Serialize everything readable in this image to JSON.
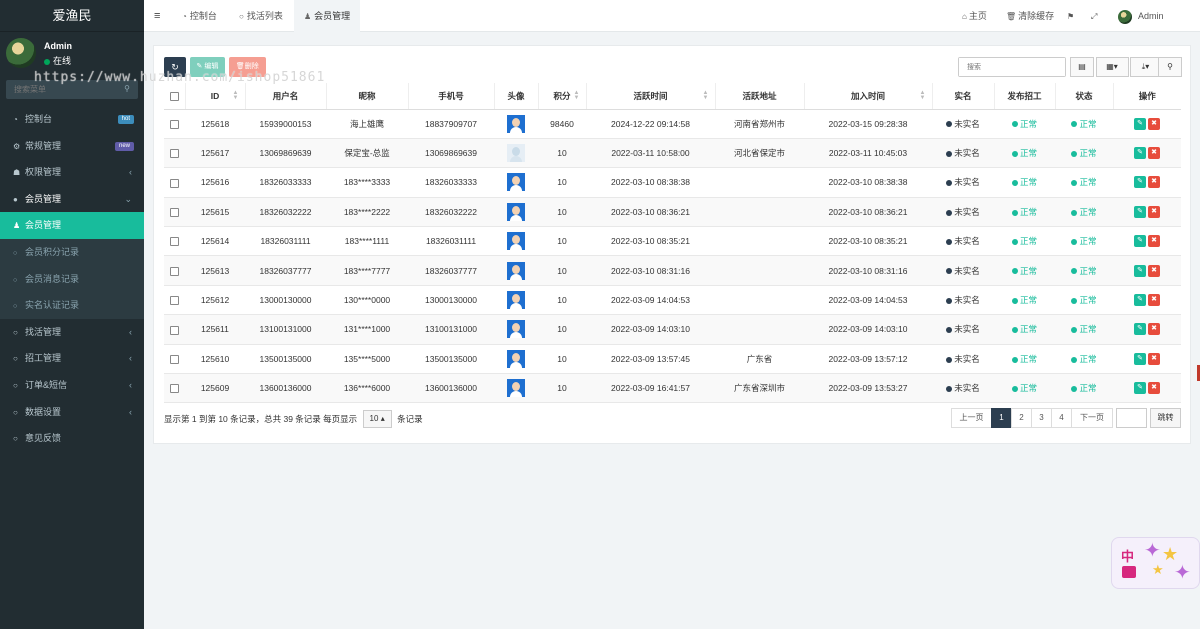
{
  "sidebar": {
    "brand": "爱渔民",
    "user": {
      "name": "Admin",
      "status": "在线"
    },
    "search_placeholder": "搜索菜单",
    "items": [
      {
        "name": "dashboard",
        "icon": "dashboard-icon",
        "glyph": "◔",
        "label": "控制台",
        "badge": "hot",
        "type": "top"
      },
      {
        "name": "general",
        "icon": "cogs-icon",
        "glyph": "⚙",
        "label": "常规管理",
        "badge": "new",
        "type": "top"
      },
      {
        "name": "permission",
        "icon": "group-icon",
        "glyph": "☗",
        "label": "权限管理",
        "arrow": "‹",
        "type": "top"
      },
      {
        "name": "members",
        "icon": "user-circle-icon",
        "glyph": "●",
        "label": "会员管理",
        "arrow": "⌄",
        "type": "open"
      },
      {
        "name": "member-manage",
        "icon": "user-icon",
        "glyph": "♟",
        "label": "会员管理",
        "type": "active"
      },
      {
        "name": "member-points",
        "icon": "circle-icon",
        "glyph": "○",
        "label": "会员积分记录",
        "type": "sub"
      },
      {
        "name": "member-messages",
        "icon": "circle-icon",
        "glyph": "○",
        "label": "会员消息记录",
        "type": "sub"
      },
      {
        "name": "member-verify",
        "icon": "circle-icon",
        "glyph": "○",
        "label": "实名认证记录",
        "type": "sub"
      },
      {
        "name": "find-jobs",
        "icon": "circle-icon",
        "glyph": "○",
        "label": "找活管理",
        "arrow": "‹",
        "type": "top"
      },
      {
        "name": "recruit",
        "icon": "circle-icon",
        "glyph": "○",
        "label": "招工管理",
        "arrow": "‹",
        "type": "top"
      },
      {
        "name": "orders-sms",
        "icon": "circle-icon",
        "glyph": "○",
        "label": "订单&短信",
        "arrow": "‹",
        "type": "top"
      },
      {
        "name": "data-settings",
        "icon": "circle-icon",
        "glyph": "○",
        "label": "数据设置",
        "arrow": "‹",
        "type": "top"
      },
      {
        "name": "feedback",
        "icon": "circle-icon",
        "glyph": "○",
        "label": "意见反馈",
        "type": "top"
      }
    ]
  },
  "watermark": "https://www.huzhan.com/ishop51861",
  "topnav": {
    "toggle": "≡",
    "tabs": [
      {
        "label": "控制台",
        "icon": "dashboard-icon",
        "glyph": "◔"
      },
      {
        "label": "找活列表",
        "icon": "circle-icon",
        "glyph": "○"
      },
      {
        "label": "会员管理",
        "icon": "user-icon",
        "glyph": "♟"
      }
    ],
    "home": "主页",
    "clear_cache": "清除缓存",
    "user": "Admin"
  },
  "toolbar": {
    "refresh": "↻",
    "edit": "编辑",
    "delete": "删除",
    "search_placeholder": "搜索"
  },
  "table": {
    "columns": [
      "",
      "ID",
      "用户名",
      "昵称",
      "手机号",
      "头像",
      "积分",
      "活跃时间",
      "活跃地址",
      "加入时间",
      "实名",
      "发布招工",
      "状态",
      "操作"
    ],
    "rows": [
      {
        "id": "125618",
        "username": "15939000153",
        "nickname": "海上雄鹰",
        "phone": "18837909707",
        "avatar": "std",
        "points": "98460",
        "active_time": "2024-12-22 09:14:58",
        "active_addr": "河南省郑州市",
        "join_time": "2022-03-15 09:28:38",
        "verified": "未实名",
        "post": "正常",
        "status": "正常"
      },
      {
        "id": "125617",
        "username": "13069869639",
        "nickname": "保定宝-总监",
        "phone": "13069869639",
        "avatar": "alt",
        "points": "10",
        "active_time": "2022-03-11 10:58:00",
        "active_addr": "河北省保定市",
        "join_time": "2022-03-11 10:45:03",
        "verified": "未实名",
        "post": "正常",
        "status": "正常"
      },
      {
        "id": "125616",
        "username": "18326033333",
        "nickname": "183****3333",
        "phone": "18326033333",
        "avatar": "std",
        "points": "10",
        "active_time": "2022-03-10 08:38:38",
        "active_addr": "",
        "join_time": "2022-03-10 08:38:38",
        "verified": "未实名",
        "post": "正常",
        "status": "正常"
      },
      {
        "id": "125615",
        "username": "18326032222",
        "nickname": "183****2222",
        "phone": "18326032222",
        "avatar": "std",
        "points": "10",
        "active_time": "2022-03-10 08:36:21",
        "active_addr": "",
        "join_time": "2022-03-10 08:36:21",
        "verified": "未实名",
        "post": "正常",
        "status": "正常"
      },
      {
        "id": "125614",
        "username": "18326031111",
        "nickname": "183****1111",
        "phone": "18326031111",
        "avatar": "std",
        "points": "10",
        "active_time": "2022-03-10 08:35:21",
        "active_addr": "",
        "join_time": "2022-03-10 08:35:21",
        "verified": "未实名",
        "post": "正常",
        "status": "正常"
      },
      {
        "id": "125613",
        "username": "18326037777",
        "nickname": "183****7777",
        "phone": "18326037777",
        "avatar": "std",
        "points": "10",
        "active_time": "2022-03-10 08:31:16",
        "active_addr": "",
        "join_time": "2022-03-10 08:31:16",
        "verified": "未实名",
        "post": "正常",
        "status": "正常"
      },
      {
        "id": "125612",
        "username": "13000130000",
        "nickname": "130****0000",
        "phone": "13000130000",
        "avatar": "std",
        "points": "10",
        "active_time": "2022-03-09 14:04:53",
        "active_addr": "",
        "join_time": "2022-03-09 14:04:53",
        "verified": "未实名",
        "post": "正常",
        "status": "正常"
      },
      {
        "id": "125611",
        "username": "13100131000",
        "nickname": "131****1000",
        "phone": "13100131000",
        "avatar": "std",
        "points": "10",
        "active_time": "2022-03-09 14:03:10",
        "active_addr": "",
        "join_time": "2022-03-09 14:03:10",
        "verified": "未实名",
        "post": "正常",
        "status": "正常"
      },
      {
        "id": "125610",
        "username": "13500135000",
        "nickname": "135****5000",
        "phone": "13500135000",
        "avatar": "std",
        "points": "10",
        "active_time": "2022-03-09 13:57:45",
        "active_addr": "广东省",
        "join_time": "2022-03-09 13:57:12",
        "verified": "未实名",
        "post": "正常",
        "status": "正常"
      },
      {
        "id": "125609",
        "username": "13600136000",
        "nickname": "136****6000",
        "phone": "13600136000",
        "avatar": "std",
        "points": "10",
        "active_time": "2022-03-09 16:41:57",
        "active_addr": "广东省深圳市",
        "join_time": "2022-03-09 13:53:27",
        "verified": "未实名",
        "post": "正常",
        "status": "正常"
      }
    ]
  },
  "footer": {
    "info": "显示第 1 到第 10 条记录，总共 39 条记录 每页显示",
    "page_size": "10",
    "suffix": "条记录"
  },
  "pagination": {
    "prev": "上一页",
    "pages": [
      "1",
      "2",
      "3",
      "4"
    ],
    "current": "1",
    "next": "下一页",
    "jump": "跳转"
  },
  "floating_badge": {
    "text": "中"
  },
  "colors": {
    "sidebar_bg": "#222d32",
    "accent": "#18bc9c",
    "danger": "#e74c3c",
    "dark": "#2c3e50"
  }
}
